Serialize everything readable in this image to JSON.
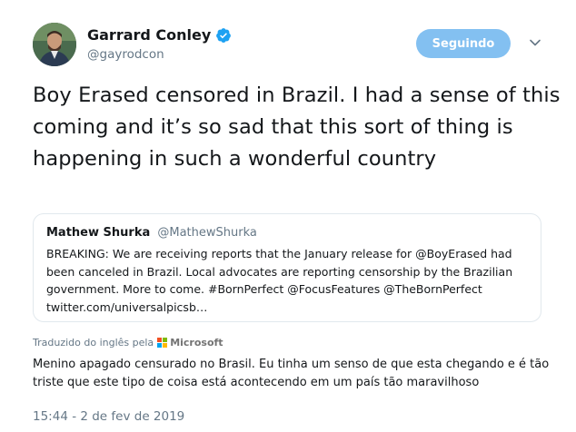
{
  "author": {
    "name": "Garrard Conley",
    "handle": "@gayrodcon",
    "verified": true
  },
  "follow_button_label": "Seguindo",
  "tweet_text": "Boy Erased censored in Brazil. I had a sense of this coming and it’s so sad that this sort of thing is happening in such a wonderful country",
  "quoted_tweet": {
    "name": "Mathew Shurka",
    "handle": "@MathewShurka",
    "text": "BREAKING: We are receiving reports that the January release for @BoyErased had been canceled in Brazil. Local advocates are reporting censorship by the Brazilian government. More to come. #BornPerfect @FocusFeatures @TheBornPerfect twitter.com/universalpicsb…"
  },
  "translation": {
    "label": "Traduzido do inglês pela",
    "provider": "Microsoft",
    "text": "Menino apagado censurado no Brasil. Eu tinha um senso de que esta chegando e é tão triste que este tipo de coisa está acontecendo em um país tão maravilhoso"
  },
  "timestamp": "15:44 - 2 de fev de 2019",
  "colors": {
    "accent": "#1da1f2",
    "follow_button_bg": "#83c0f1",
    "muted_text": "#657786",
    "border": "#e1e8ed"
  },
  "icons": [
    "verified-badge-icon",
    "chevron-down-icon",
    "microsoft-logo-icon"
  ]
}
